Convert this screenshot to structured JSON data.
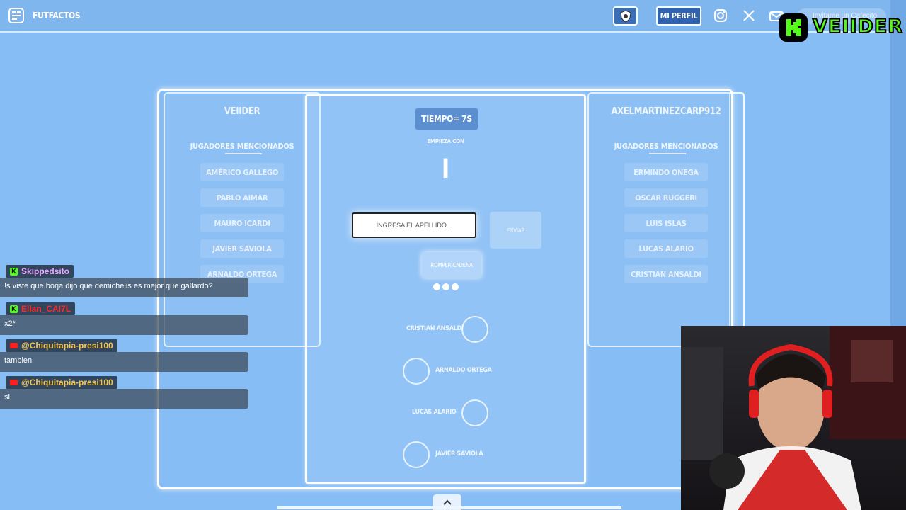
{
  "navbar": {
    "brand": "FUTFACTOS",
    "profile_label": "MI PERFIL",
    "cafecito_label": "Invitame un Cafecito",
    "icons": [
      "shield-icon",
      "instagram-icon",
      "x-icon",
      "mail-icon"
    ]
  },
  "overlay": {
    "kick_channel": "VEIIDER"
  },
  "game": {
    "left_player": {
      "name": "VEIIDER",
      "mentions_title": "JUGADORES MENCIONADOS",
      "mentions": [
        "AMÉRICO GALLEGO",
        "PABLO AIMAR",
        "MAURO ICARDI",
        "JAVIER SAVIOLA",
        "ARNALDO ORTEGA"
      ]
    },
    "right_player": {
      "name": "AXELMARTINEZCARP912",
      "mentions_title": "JUGADORES MENCIONADOS",
      "mentions": [
        "ERMINDO ONEGA",
        "OSCAR RUGGERI",
        "LUIS ISLAS",
        "LUCAS ALARIO",
        "CRISTIAN ANSALDI"
      ]
    },
    "center": {
      "timer": "TIEMPO= 7S",
      "starts_with_label": "EMPIEZA CON",
      "starts_with_letter": "I",
      "input_value": "INGRESA EL APELLIDO...",
      "send_label": "ENVIAR",
      "break_chain_label": "ROMPER CADENA",
      "chain": [
        "CRISTIAN ANSALDI",
        "ARNALDO ORTEGA",
        "LUCAS ALARIO",
        "JAVIER SAVIOLA"
      ]
    }
  },
  "chat": [
    {
      "platform": "kick",
      "user": "Skippedsito",
      "user_color": "#e9a6ff",
      "text": "!s viste que borja dijo que demichelis es mejor que gallardo?"
    },
    {
      "platform": "kick",
      "user": "Ellan_CAI7L",
      "user_color": "#ff2a2a",
      "text": "x2*"
    },
    {
      "platform": "youtube",
      "user": "@Chiquitapia-presi100",
      "user_color": "#f5c64a",
      "text": "tambien"
    },
    {
      "platform": "youtube",
      "user": "@Chiquitapia-presi100",
      "user_color": "#f5c64a",
      "text": "si"
    }
  ]
}
